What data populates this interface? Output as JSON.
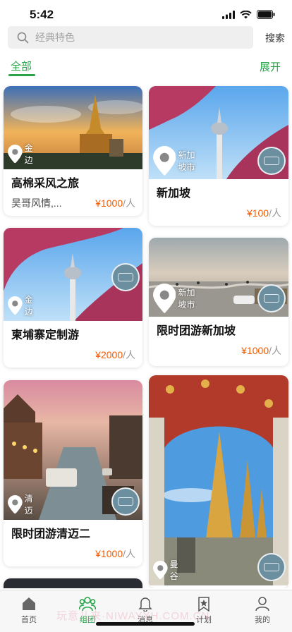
{
  "status": {
    "time": "5:42"
  },
  "search": {
    "placeholder": "经典特色",
    "button": "搜索"
  },
  "filter": {
    "active": "全部",
    "expand": "展开"
  },
  "cards": [
    {
      "title": "高棉采风之旅",
      "subtitle": "吴哥风情,...",
      "price": "¥1000",
      "unit": "/人",
      "location": "金边"
    },
    {
      "title": "新加坡",
      "price": "¥100",
      "unit": "/人",
      "location": "新加坡市"
    },
    {
      "title": "柬埔寨定制游",
      "price": "¥2000",
      "unit": "/人",
      "location": "金边"
    },
    {
      "title": "限时团游新加坡",
      "price": "¥1000",
      "unit": "/人",
      "location": "新加坡市"
    },
    {
      "title": "限时团游清迈二",
      "price": "¥1000",
      "unit": "/人",
      "location": "清迈"
    },
    {
      "title": "",
      "price": "",
      "unit": "",
      "location": "曼谷"
    }
  ],
  "tabbar": [
    {
      "label": "首页",
      "icon": "home-icon"
    },
    {
      "label": "组团",
      "icon": "group-icon",
      "active": true
    },
    {
      "label": "消息",
      "icon": "bell-icon"
    },
    {
      "label": "计划",
      "icon": "bookmark-star-icon"
    },
    {
      "label": "我的",
      "icon": "person-icon"
    }
  ],
  "watermark": "玩意儿来·NIWAYXH.COM.CN",
  "colors": {
    "accent": "#2aa34a",
    "price": "#f25a00"
  }
}
